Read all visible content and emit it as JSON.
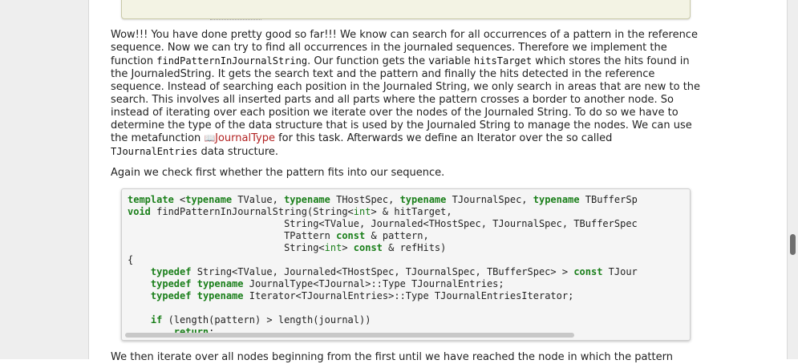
{
  "paragraph1": {
    "t1": "Wow!!! You have done pretty good so far!!! We know can search for all occurrences of a pattern in the reference sequence. Now we can try to find all occurrences in the journaled sequences. Therefore we implement the function ",
    "c1": "findPatternInJournalString",
    "t2": ". Our function gets the variable ",
    "c2": "hitsTarget",
    "t3": " which stores the hits found in the JournaledString. It gets the search text and the pattern and finally the hits detected in the reference sequence. Instead of searching each position in the Journaled String, we only search in areas that are new to the search. This involves all inserted parts and all parts where the pattern crosses a border to another node. So instead of iterating over each position we iterate over the nodes of the Journaled String. To do so we have to determine the type of the data structure that is used by the Journaled String to manage the nodes. We can use the metafunction ",
    "link": "JournalType",
    "t4": " for this task. Afterwards we define an Iterator over the so called ",
    "c3": "TJournalEntries",
    "t5": " data structure."
  },
  "paragraph2": "Again we check first whether the pattern fits into our sequence.",
  "paragraph3": "We then iterate over all nodes beginning from the first until we have reached the node in which the pattern",
  "code": {
    "l1a": "template",
    "l1b": " <",
    "l1c": "typename",
    "l1d": " TValue, ",
    "l1e": "typename",
    "l1f": " THostSpec, ",
    "l1g": "typename",
    "l1h": " TJournalSpec, ",
    "l1i": "typename",
    "l1j": " TBufferSp",
    "l2a": "void",
    "l2b": " findPatternInJournalString(String<",
    "l2c": "int",
    "l2d": "> & hitTarget,",
    "l3": "                           String<TValue, Journaled<THostSpec, TJournalSpec, TBufferSpec",
    "l4a": "                           TPattern ",
    "l4b": "const",
    "l4c": " & pattern,",
    "l5a": "                           String<",
    "l5b": "int",
    "l5c": "> ",
    "l5d": "const",
    "l5e": " & refHits)",
    "l6": "{",
    "l7a": "    ",
    "l7b": "typedef",
    "l7c": " String<TValue, Journaled<THostSpec, TJournalSpec, TBufferSpec> > ",
    "l7d": "const",
    "l7e": " TJour",
    "l8a": "    ",
    "l8b": "typedef",
    "l8c": " ",
    "l8d": "typename",
    "l8e": " JournalType<TJournal>::Type TJournalEntries;",
    "l9a": "    ",
    "l9b": "typedef",
    "l9c": " ",
    "l9d": "typename",
    "l9e": " Iterator<TJournalEntries>::Type TJournalEntriesIterator;",
    "l10": "",
    "l11a": "    ",
    "l11b": "if",
    "l11c": " (length(pattern) > length(journal))",
    "l12a": "        ",
    "l12b": "return",
    "l12c": ";"
  }
}
